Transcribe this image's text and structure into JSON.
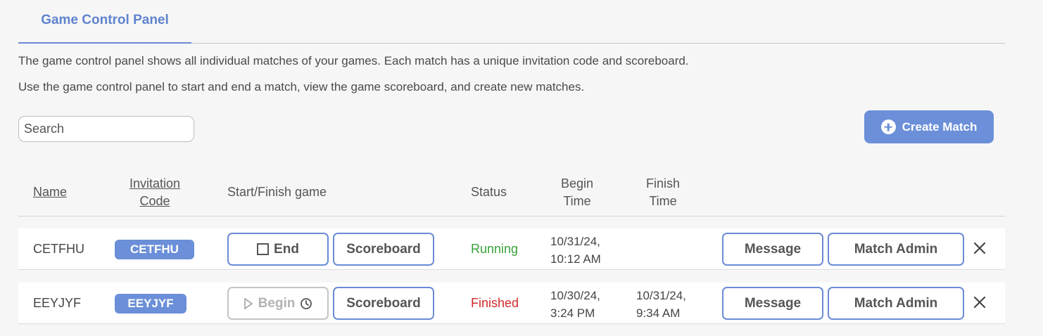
{
  "tabs": [
    {
      "label": "Game Control Panel"
    }
  ],
  "description": {
    "line1": "The game control panel shows all individual matches of your games. Each match has a unique invitation code and scoreboard.",
    "line2": "Use the game control panel to start and end a match, view the game scoreboard, and create new matches."
  },
  "search": {
    "placeholder": "Search",
    "value": ""
  },
  "create_button": {
    "label": "Create Match",
    "icon": "plus-circle-icon"
  },
  "columns": {
    "name": "Name",
    "invitation_code": [
      "Invitation",
      "Code"
    ],
    "start_finish": "Start/Finish game",
    "status": "Status",
    "begin_time": [
      "Begin",
      "Time"
    ],
    "finish_time": [
      "Finish",
      "Time"
    ]
  },
  "rows": [
    {
      "name": "CETFHU",
      "code": "CETFHU",
      "action_label": "End",
      "action_icon": "stop-icon",
      "scoreboard_label": "Scoreboard",
      "status": "Running",
      "begin_time": [
        "10/31/24,",
        "10:12 AM"
      ],
      "finish_time": [
        "",
        ""
      ],
      "message_label": "Message",
      "admin_label": "Match Admin"
    },
    {
      "name": "EEYJYF",
      "code": "EEYJYF",
      "action_label": "Begin",
      "action_icon": "play-icon",
      "scoreboard_label": "Scoreboard",
      "status": "Finished",
      "begin_time": [
        "10/30/24,",
        "3:24 PM"
      ],
      "finish_time": [
        "10/31/24,",
        "9:34 AM"
      ],
      "message_label": "Message",
      "admin_label": "Match Admin"
    }
  ],
  "colors": {
    "accent": "#6b8fd8",
    "running": "#3aa13a",
    "finished": "#d02a2a"
  }
}
